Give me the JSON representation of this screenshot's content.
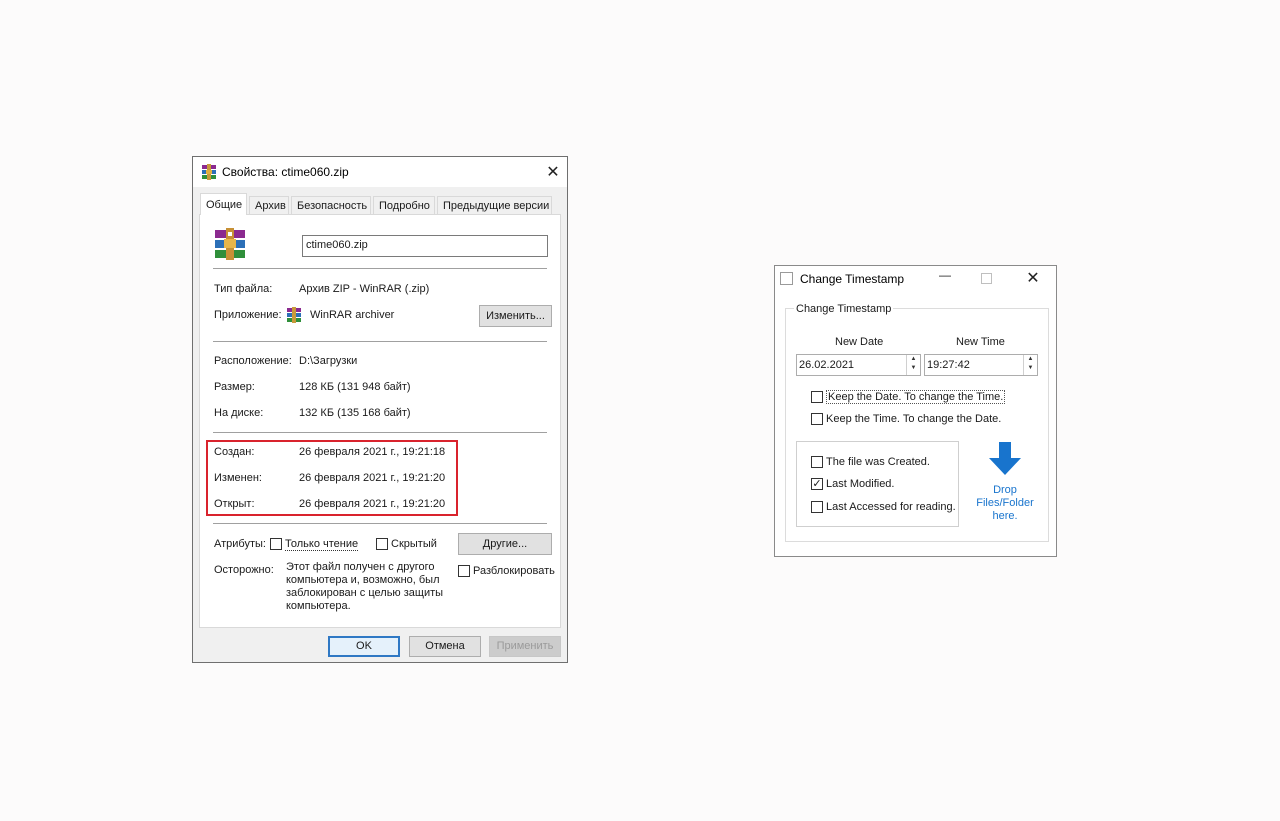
{
  "properties": {
    "title": "Свойства: ctime060.zip",
    "tabs": [
      "Общие",
      "Архив",
      "Безопасность",
      "Подробно",
      "Предыдущие версии"
    ],
    "filename": "ctime060.zip",
    "type_label": "Тип файла:",
    "type_value": "Архив ZIP - WinRAR (.zip)",
    "app_label": "Приложение:",
    "app_value": "WinRAR archiver",
    "change_button": "Изменить...",
    "location_label": "Расположение:",
    "location_value": "D:\\Загрузки",
    "size_label": "Размер:",
    "size_value": "128 КБ (131 948 байт)",
    "disk_label": "На диске:",
    "disk_value": "132 КБ (135 168 байт)",
    "created_label": "Создан:",
    "created_value": "26 февраля 2021 г., 19:21:18",
    "modified_label": "Изменен:",
    "modified_value": "26 февраля 2021 г., 19:21:20",
    "opened_label": "Открыт:",
    "opened_value": "26 февраля 2021 г., 19:21:20",
    "attributes_label": "Атрибуты:",
    "readonly_label": "Только чтение",
    "hidden_label": "Скрытый",
    "other_button": "Другие...",
    "caution_label": "Осторожно:",
    "caution_text_1": "Этот файл получен с другого",
    "caution_text_2": "компьютера и, возможно, был",
    "caution_text_3": "заблокирован с целью защиты",
    "caution_text_4": "компьютера.",
    "unblock_label": "Разблокировать",
    "ok_button": "OK",
    "cancel_button": "Отмена",
    "apply_button": "Применить",
    "highlight_color": "#d9232d"
  },
  "timestamp": {
    "title": "Change Timestamp",
    "group_label": "Change Timestamp",
    "new_date_label": "New Date",
    "new_time_label": "New Time",
    "date_value": "26.02.2021",
    "time_value": "19:27:42",
    "keep_date_label": "Keep the Date. To change the Time.",
    "keep_time_label": "Keep the Time. To change the Date.",
    "created_label": "The file was Created.",
    "modified_label": "Last Modified.",
    "accessed_label": "Last Accessed for reading.",
    "modified_checked": true,
    "drop_line_1": "Drop",
    "drop_line_2": "Files/Folder",
    "drop_line_3": "here.",
    "accent_color": "#1874cd"
  }
}
